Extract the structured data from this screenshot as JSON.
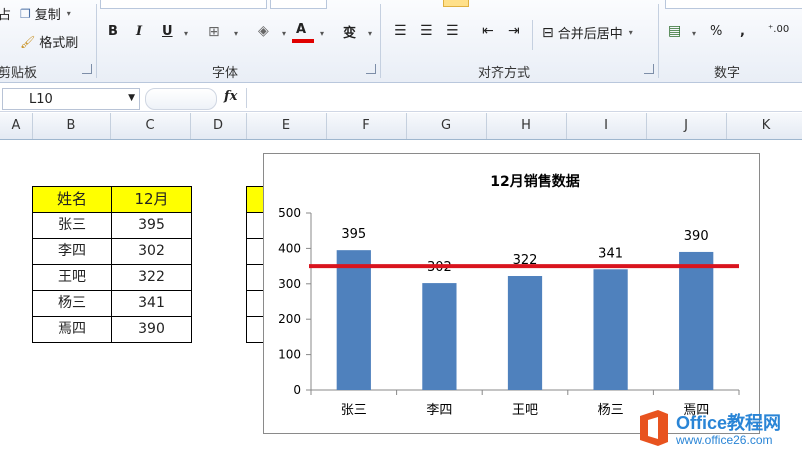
{
  "ribbon": {
    "clipboard": {
      "paste_partial": "占",
      "copy_label": "复制",
      "format_painter_label": "格式刷",
      "group_label": "剪贴板"
    },
    "font": {
      "bold": "B",
      "italic": "I",
      "underline": "U",
      "border_icon": "border-icon",
      "fill_color_icon": "fill-color-icon",
      "font_color": "A",
      "font_color_bar": "#e00000",
      "phonetic": "变",
      "group_label": "字体"
    },
    "alignment": {
      "merge_center_label": "合并后居中",
      "group_label": "对齐方式"
    },
    "number": {
      "percent": "%",
      "comma": ",",
      "group_label": "数字"
    }
  },
  "formula_bar": {
    "name_box": "L10",
    "fx": "fx",
    "formula": ""
  },
  "columns": [
    "A",
    "B",
    "C",
    "D",
    "E",
    "F",
    "G",
    "H",
    "I",
    "J",
    "K"
  ],
  "table": {
    "headers": [
      "姓名",
      "12月"
    ],
    "rows": [
      [
        "张三",
        "395"
      ],
      [
        "李四",
        "302"
      ],
      [
        "王吧",
        "322"
      ],
      [
        "杨三",
        "341"
      ],
      [
        "焉四",
        "390"
      ]
    ],
    "header_color": "#ffff00"
  },
  "chart_data": {
    "type": "bar",
    "title": "12月销售数据",
    "categories": [
      "张三",
      "李四",
      "王吧",
      "杨三",
      "焉四"
    ],
    "values": [
      395,
      302,
      322,
      341,
      390
    ],
    "data_labels": [
      "395",
      "302",
      "322",
      "341",
      "390"
    ],
    "ylim": [
      0,
      500
    ],
    "yticks": [
      "0",
      "100",
      "200",
      "300",
      "400",
      "500"
    ],
    "bar_color": "#4f81bd",
    "reference_line": {
      "value": 350,
      "color": "#d9141e"
    },
    "xlabel": "",
    "ylabel": "",
    "grid": false
  },
  "watermark": {
    "brand": "Office教程网",
    "url": "www.office26.com"
  }
}
